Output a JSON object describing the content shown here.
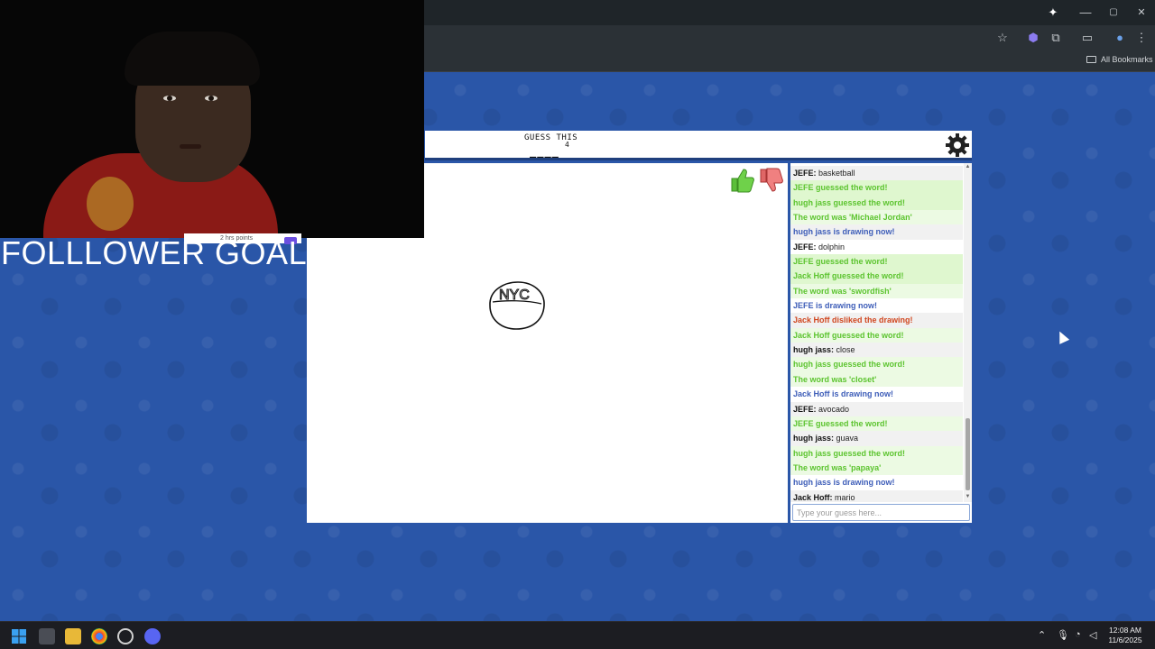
{
  "browser": {
    "bookmarks_label": "All Bookmarks",
    "window_controls": [
      "—",
      "▢",
      "✕"
    ]
  },
  "game": {
    "guess_label": "GUESS THIS",
    "letter_count": "4",
    "blanks": "____",
    "drawing_text": "NYC"
  },
  "chat": {
    "messages": [
      {
        "sender": "JEFE:",
        "text": " basketball",
        "style": "plain"
      },
      {
        "text": "JEFE guessed the word!",
        "style": "green"
      },
      {
        "text": "hugh jass guessed the word!",
        "style": "green"
      },
      {
        "text": "The word was 'Michael Jordan'",
        "style": "greenlight"
      },
      {
        "text": "hugh jass is drawing now!",
        "style": "blue"
      },
      {
        "sender": "JEFE:",
        "text": " dolphin",
        "style": "plain"
      },
      {
        "text": "JEFE guessed the word!",
        "style": "green"
      },
      {
        "text": "Jack Hoff guessed the word!",
        "style": "green"
      },
      {
        "text": "The word was 'swordfish'",
        "style": "greenlight"
      },
      {
        "text": "JEFE is drawing now!",
        "style": "blue"
      },
      {
        "text": "Jack Hoff disliked the drawing!",
        "style": "red"
      },
      {
        "text": "Jack Hoff guessed the word!",
        "style": "greenlight"
      },
      {
        "sender": "hugh jass:",
        "text": " close",
        "style": "plain"
      },
      {
        "text": "hugh jass guessed the word!",
        "style": "greenlight"
      },
      {
        "text": "The word was 'closet'",
        "style": "greenlight"
      },
      {
        "text": "Jack Hoff is drawing now!",
        "style": "blue"
      },
      {
        "sender": "JEFE:",
        "text": " avocado",
        "style": "plain"
      },
      {
        "text": "JEFE guessed the word!",
        "style": "greenlight"
      },
      {
        "sender": "hugh jass:",
        "text": " guava",
        "style": "plain"
      },
      {
        "text": "hugh jass guessed the word!",
        "style": "greenlight"
      },
      {
        "text": "The word was 'papaya'",
        "style": "greenlight"
      },
      {
        "text": "hugh jass is drawing now!",
        "style": "blue"
      },
      {
        "sender": "Jack Hoff:",
        "text": " mario",
        "style": "plain"
      }
    ],
    "input_placeholder": "Type your guess here..."
  },
  "overlay": {
    "follower_goal": "FOLLLOWER GOAL",
    "points_text": "2 hrs points"
  },
  "taskbar": {
    "time": "12:08 AM",
    "date": "11/6/2025"
  },
  "colors": {
    "page_blue": "#2a56a8",
    "chat_green": "#5cc42f",
    "chat_blue": "#3d5db8",
    "chat_red": "#d0461f"
  }
}
